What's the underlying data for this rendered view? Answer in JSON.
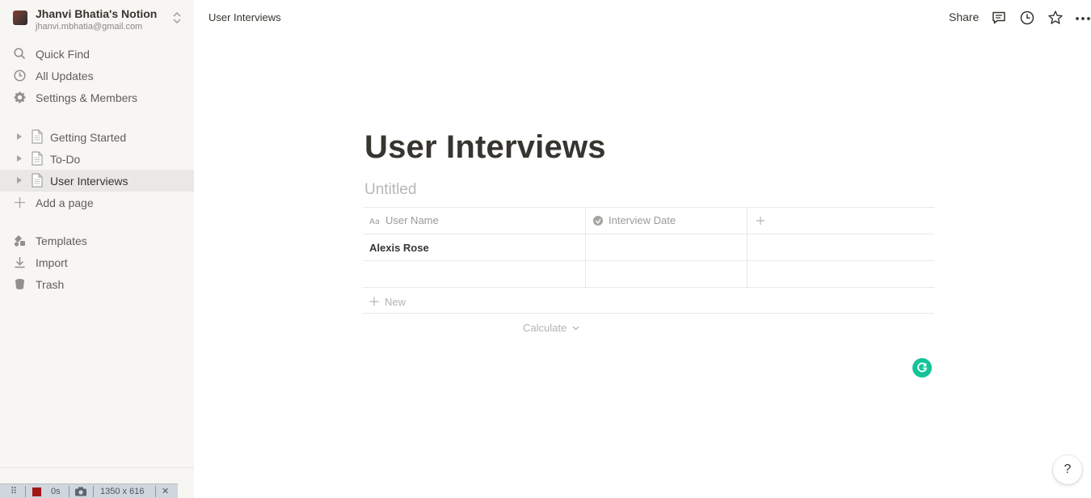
{
  "workspace": {
    "name": "Jhanvi Bhatia's Notion",
    "email": "jhanvi.mbhatia@gmail.com"
  },
  "sidebar": {
    "top_items": [
      {
        "label": "Quick Find",
        "icon": "search-icon"
      },
      {
        "label": "All Updates",
        "icon": "clock-icon"
      },
      {
        "label": "Settings & Members",
        "icon": "gear-icon"
      }
    ],
    "pages": [
      {
        "label": "Getting Started",
        "active": false
      },
      {
        "label": "To-Do",
        "active": false
      },
      {
        "label": "User Interviews",
        "active": true
      }
    ],
    "add_page": "Add a page",
    "bottom_items": [
      {
        "label": "Templates",
        "icon": "templates-icon"
      },
      {
        "label": "Import",
        "icon": "import-icon"
      },
      {
        "label": "Trash",
        "icon": "trash-icon"
      }
    ]
  },
  "topbar": {
    "breadcrumb": "User Interviews",
    "share_label": "Share"
  },
  "page": {
    "title": "User Interviews",
    "database_title": "Untitled",
    "columns": [
      {
        "label": "User Name",
        "icon": "text-property-icon"
      },
      {
        "label": "Interview Date",
        "icon": "date-property-icon"
      }
    ],
    "rows": [
      {
        "user_name": "Alexis Rose",
        "interview_date": ""
      },
      {
        "user_name": "",
        "interview_date": ""
      }
    ],
    "new_label": "New",
    "calculate_label": "Calculate"
  },
  "help_label": "?",
  "recorder": {
    "time": "0s",
    "size": "1350 x 616"
  },
  "colors": {
    "sidebar_bg": "#f7f6f3",
    "text": "#37352f",
    "muted": "#9b9a97",
    "grammarly": "#15c39a"
  }
}
